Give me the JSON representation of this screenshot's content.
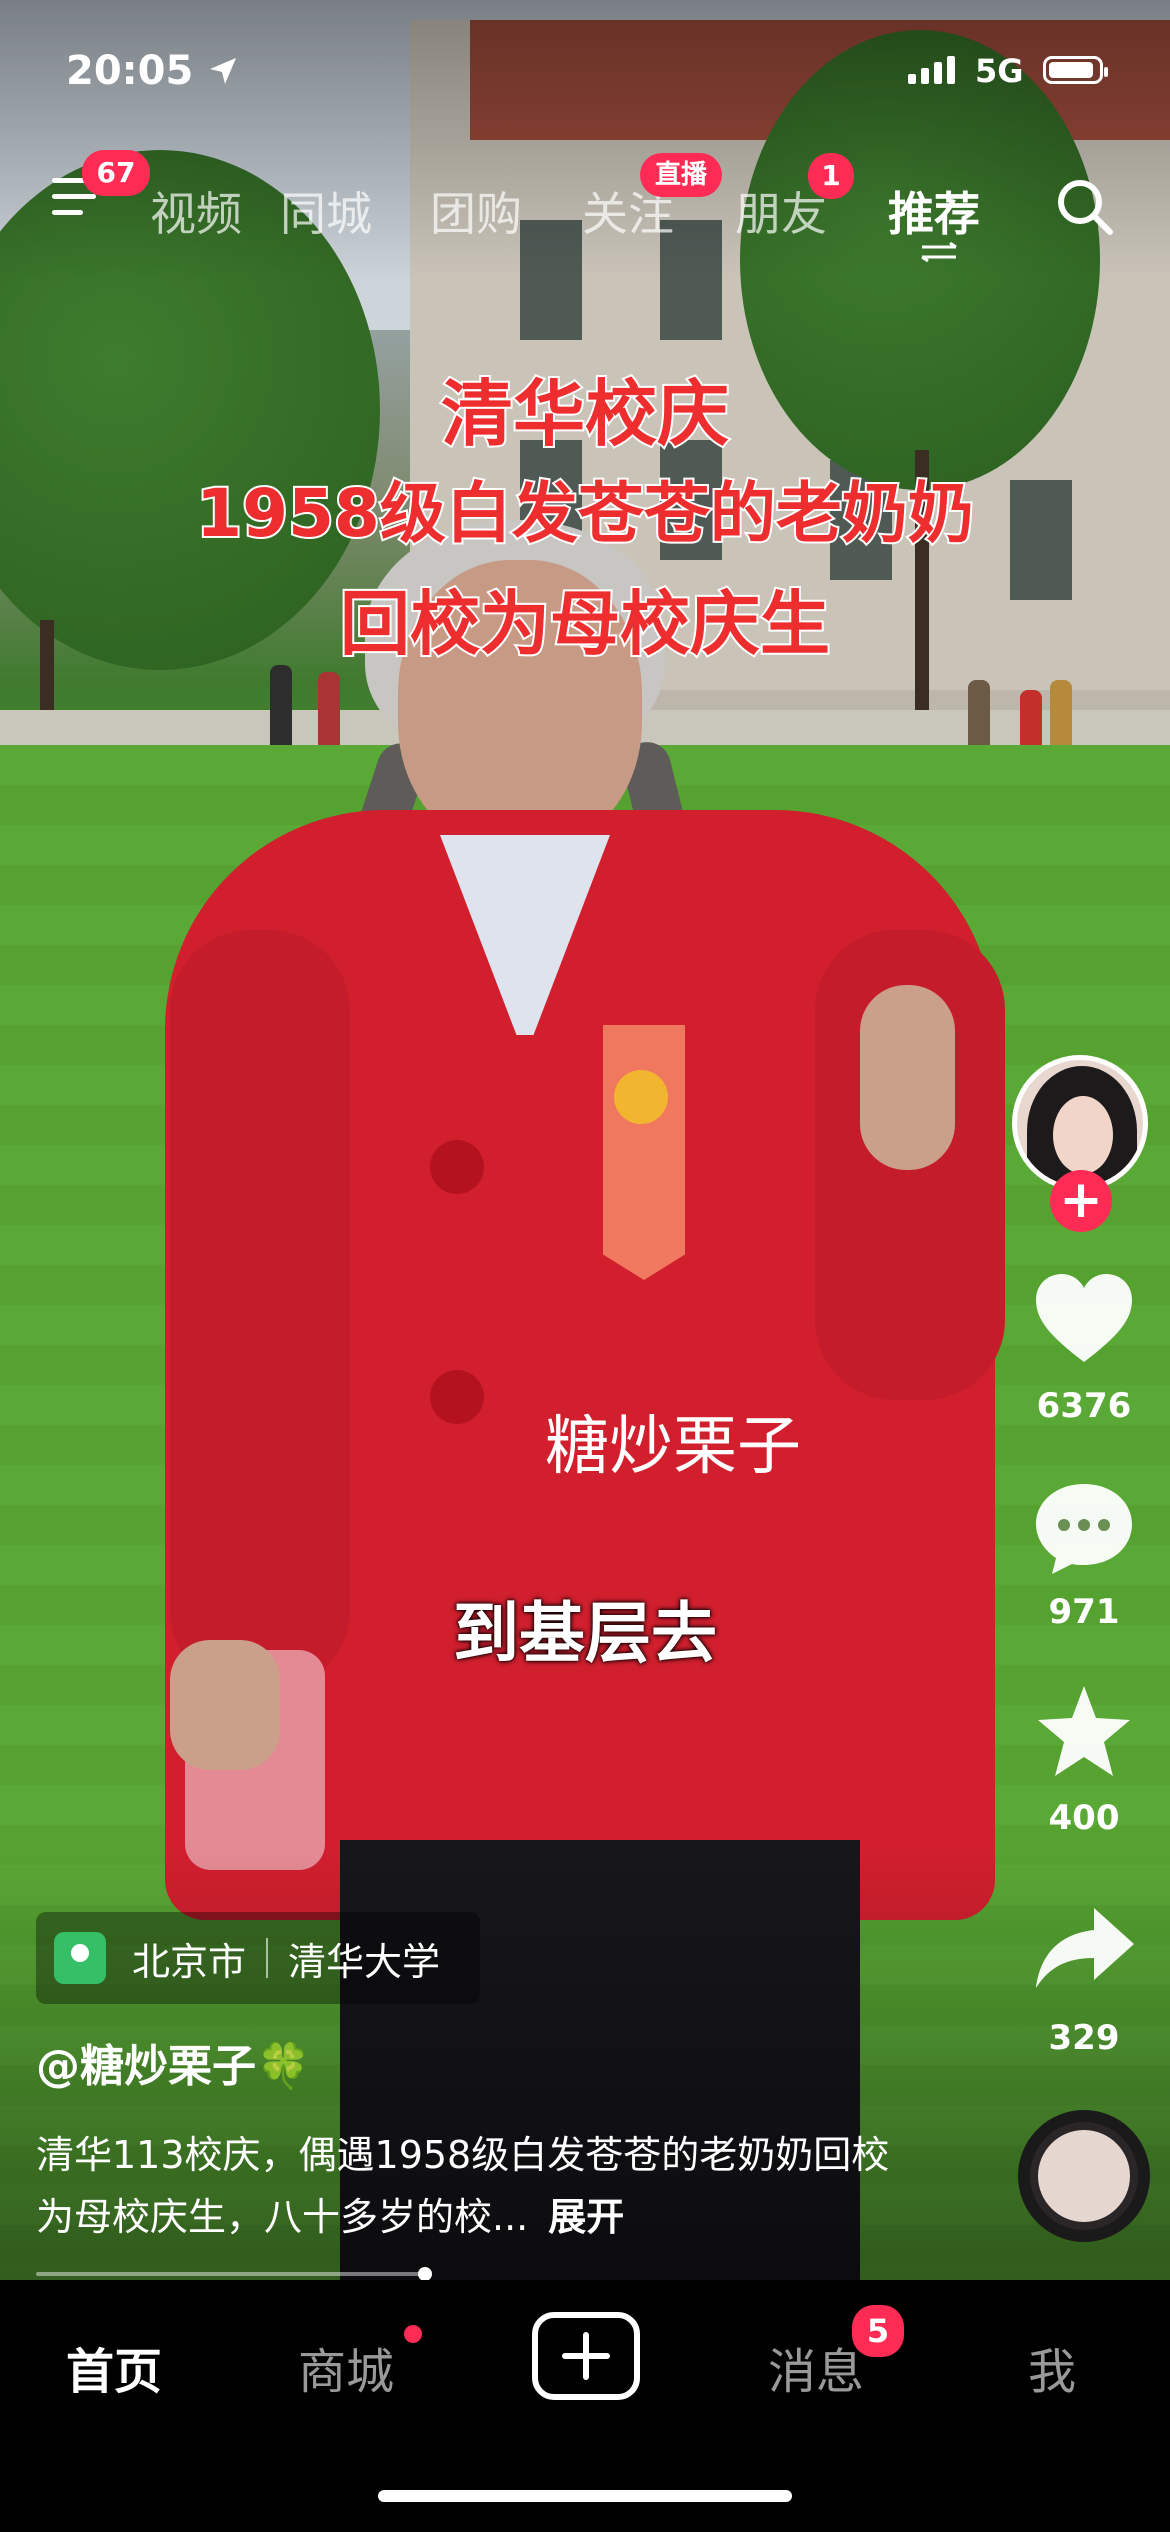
{
  "status_bar": {
    "time": "20:05",
    "network": "5G"
  },
  "top_nav": {
    "menu_badge": "67",
    "tabs": [
      {
        "label": "视频"
      },
      {
        "label": "同城"
      },
      {
        "label": "团购"
      },
      {
        "label": "关注",
        "badge": "直播"
      },
      {
        "label": "朋友",
        "badge": "1"
      },
      {
        "label": "推荐",
        "active": true
      }
    ]
  },
  "video": {
    "title_lines": [
      "清华校庆",
      "1958级白发苍苍的老奶奶",
      "回校为母校庆生"
    ],
    "watermark": "糖炒栗子",
    "subtitle": "到基层去",
    "title_color": "#ee2e2e"
  },
  "actions": {
    "likes": "6376",
    "comments": "971",
    "favorites": "400",
    "shares": "329"
  },
  "caption": {
    "location_city": "北京市",
    "location_place": "清华大学",
    "author": "@糖炒栗子🍀",
    "description": "清华113校庆，偶遇1958级白发苍苍的老奶奶回校为母校庆生，八十多岁的校...",
    "expand_label": "展开"
  },
  "tab_bar": {
    "home": "首页",
    "mall": "商城",
    "messages": "消息",
    "messages_badge": "5",
    "me": "我"
  },
  "colors": {
    "accent": "#fe2c55",
    "location_pin": "#35c068"
  }
}
